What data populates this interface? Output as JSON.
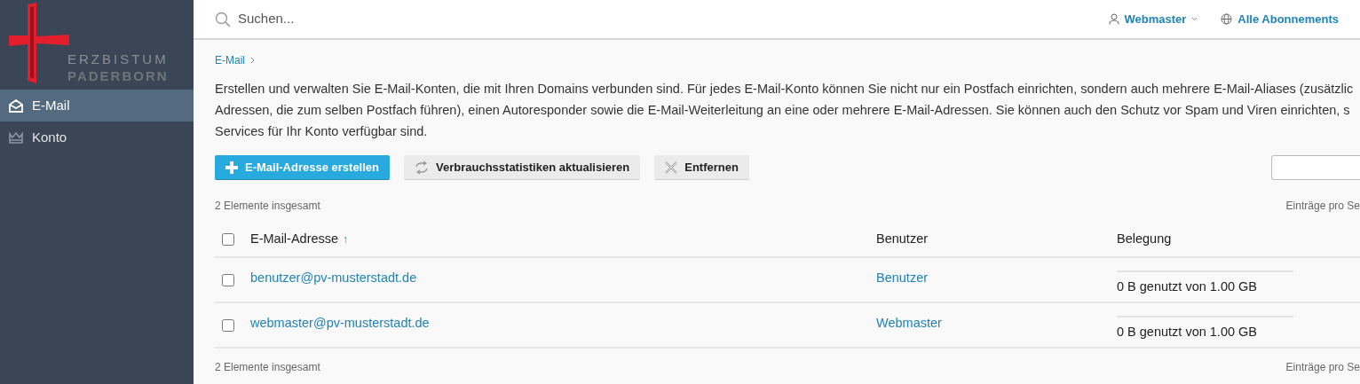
{
  "logo": {
    "line_1": "ERZBISTUM",
    "line_2": "PADERBORN"
  },
  "sidebar": {
    "items": [
      {
        "label": "E-Mail",
        "kind": "mail",
        "selected": true
      },
      {
        "label": "Konto",
        "kind": "crown",
        "selected": false
      }
    ]
  },
  "header": {
    "search": {
      "placeholder": "Suchen..."
    },
    "user": "Webmaster",
    "subscriptions": "Alle Abonnements"
  },
  "breadcrumb": [
    "E-Mail"
  ],
  "description": [
    "Erstellen und verwalten Sie E-Mail-Konten, die mit Ihren Domains verbunden sind. Für jedes E-Mail-Konto können Sie nicht nur ein Postfach einrichten, sondern auch mehrere E-Mail-Aliases (zusätzlic",
    "Adressen, die zum selben Postfach führen), einen Autoresponder sowie die E-Mail-Weiterleitung an eine oder mehrere E-Mail-Adressen. Sie können auch den Schutz vor Spam und Viren einrichten, s",
    "Services für Ihr Konto verfügbar sind."
  ],
  "toolbar": [
    {
      "label": "E-Mail-Adresse erstellen",
      "kind": "primary"
    },
    {
      "label": "Verbrauchsstatistiken aktualisieren",
      "kind": "refresh"
    },
    {
      "label": "Entfernen",
      "kind": "remove"
    }
  ],
  "total_top": "2 Elemente insgesamt",
  "per_page_top": "Einträge pro Se",
  "table": {
    "columns": [
      {
        "label": "E-Mail-Adresse",
        "sort": "↑"
      },
      {
        "label": "Benutzer"
      },
      {
        "label": "Belegung"
      }
    ],
    "select_all": {
      "checked": false
    },
    "rows": [
      {
        "checked": false,
        "email": "benutzer@pv-musterstadt.de",
        "user": "Benutzer",
        "level": 0,
        "usage": "0 B genutzt von 1.00 GB"
      },
      {
        "checked": false,
        "email": "webmaster@pv-musterstadt.de",
        "user": "Webmaster",
        "level": 0,
        "usage": "0 B genutzt von 1.00 GB"
      }
    ]
  },
  "total_bottom": "2 Elemente insgesamt",
  "per_page_bottom": "Einträge pro Se"
}
